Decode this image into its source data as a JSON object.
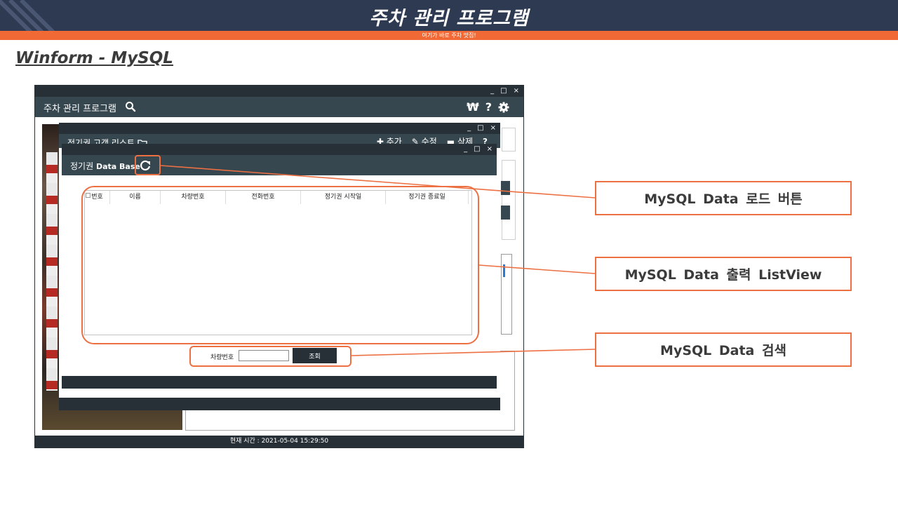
{
  "slide": {
    "title": "주차 관리 프로그램",
    "subtitle": "여기가 바로 주차 맛집!",
    "section_title": "Winform - MySQL"
  },
  "window_controls": {
    "minimize": "_",
    "maximize": "□",
    "close": "×"
  },
  "main_window": {
    "title": "주차 관리 프로그램",
    "search_icon": "search-icon",
    "tools": {
      "currency": "₩",
      "help": "?",
      "settings_icon": "gear-icon"
    },
    "status": "현재 시간 : 2021-05-04 15:29:50"
  },
  "middle_window": {
    "title": "정기권 고객 리스트",
    "folder_icon": "folder-icon",
    "tools": {
      "add": "추가",
      "edit": "수정",
      "delete": "삭제"
    }
  },
  "front_window": {
    "title": "정기권",
    "title_bold": "Data Base",
    "refresh_icon": "refresh-icon",
    "listview": {
      "columns": [
        "번호",
        "이름",
        "차량번호",
        "전화번호",
        "정기권 시작일",
        "정기권 종료일"
      ],
      "rows": []
    },
    "search": {
      "label": "차량번호",
      "value": "",
      "button": "조회"
    }
  },
  "callouts": {
    "load_button": "MySQL Data 로드 버튼",
    "listview": "MySQL Data 출력 ListView",
    "search": "MySQL Data 검색"
  },
  "colors": {
    "header_bg": "#2d3a52",
    "accent_orange": "#f16a35",
    "window_dark": "#263036",
    "window_header": "#37474f"
  }
}
